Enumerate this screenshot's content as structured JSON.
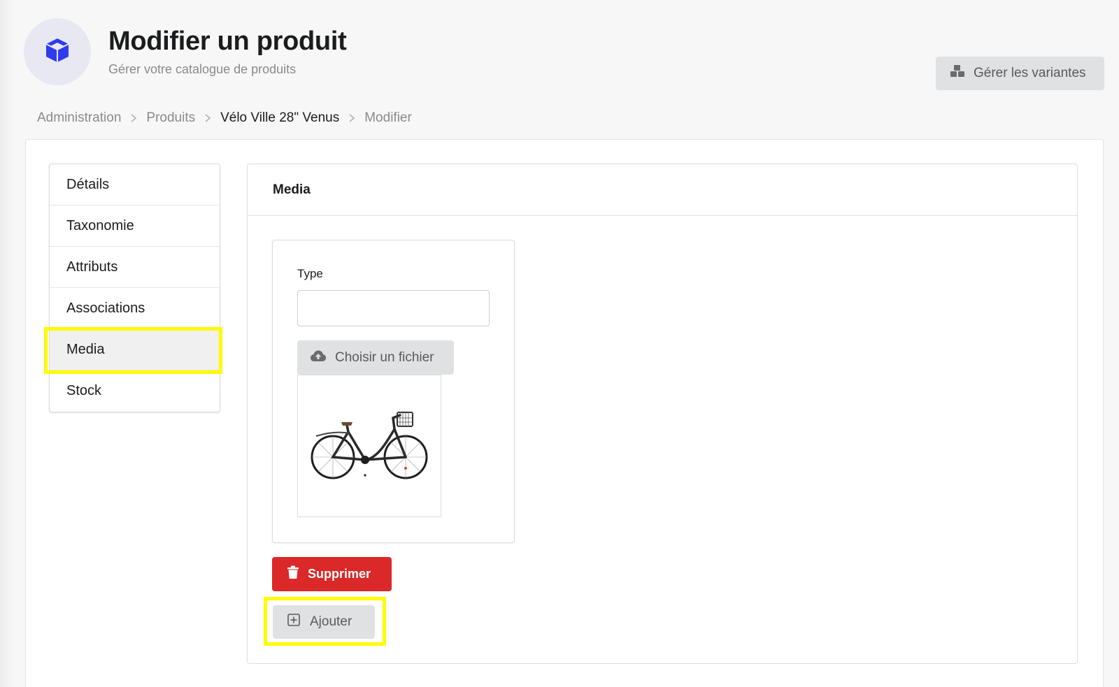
{
  "header": {
    "title": "Modifier un produit",
    "subtitle": "Gérer votre catalogue de produits",
    "icon": "cube-icon",
    "accent_color": "#2e3bef"
  },
  "actions": {
    "manage_variants_label": "Gérer les variantes",
    "manage_variants_icon": "cubes-icon"
  },
  "breadcrumb": {
    "items": [
      "Administration",
      "Produits",
      "Vélo Ville 28\" Venus",
      "Modifier"
    ]
  },
  "sidebar": {
    "items": [
      {
        "label": "Détails"
      },
      {
        "label": "Taxonomie"
      },
      {
        "label": "Attributs"
      },
      {
        "label": "Associations"
      },
      {
        "label": "Media"
      },
      {
        "label": "Stock"
      }
    ],
    "active": "Media"
  },
  "content": {
    "section_title": "Media",
    "type_label": "Type",
    "type_value": "",
    "choose_file_label": "Choisir un fichier",
    "image_description": "bicycle-image",
    "delete_label": "Supprimer",
    "add_label": "Ajouter"
  },
  "colors": {
    "highlight": "#fffb00",
    "danger": "#db2828",
    "button_grey": "#e0e1e2"
  }
}
